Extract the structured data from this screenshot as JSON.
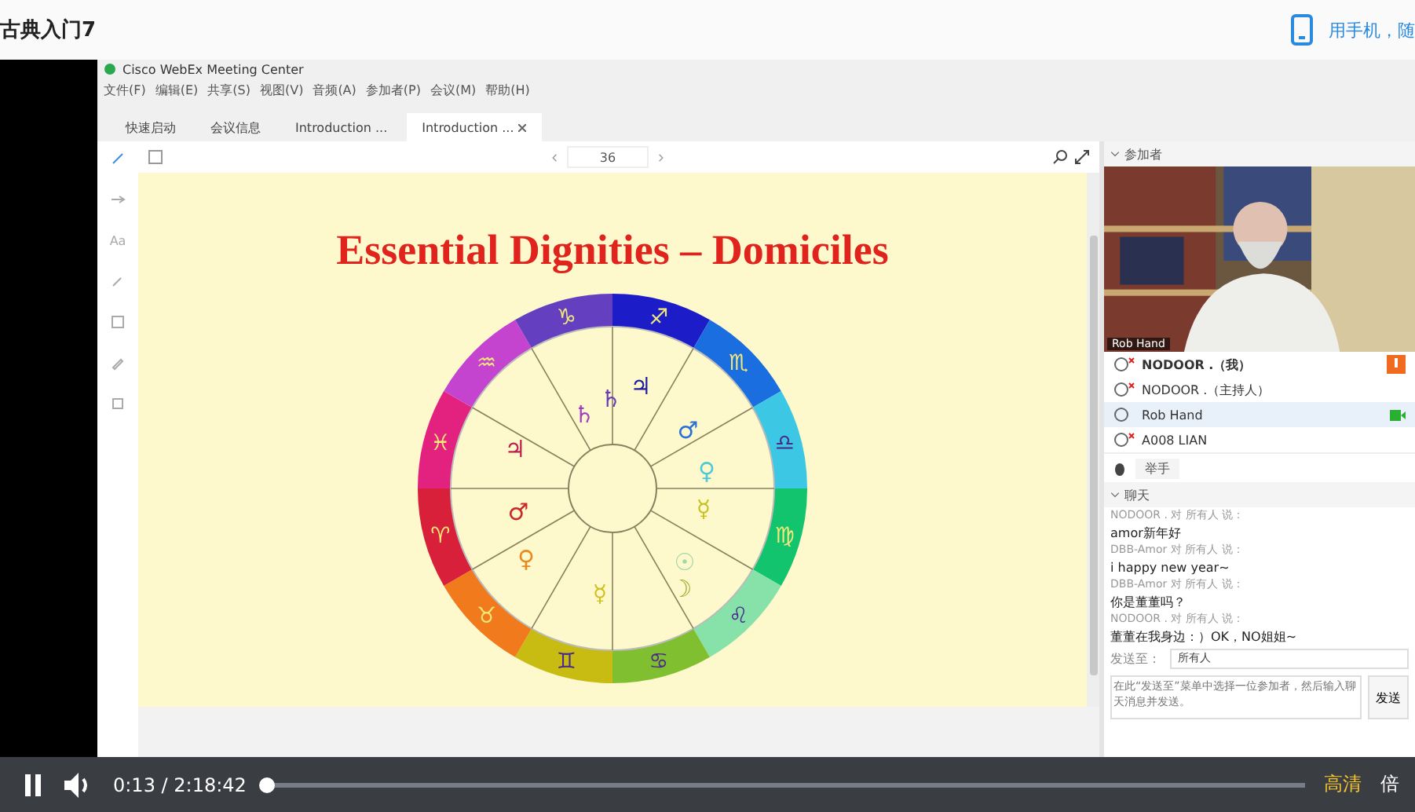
{
  "page": {
    "title": "古典入门7",
    "mobile_link": "用手机，随"
  },
  "window": {
    "title": "Cisco WebEx Meeting Center"
  },
  "menu": [
    "文件(F)",
    "编辑(E)",
    "共享(S)",
    "视图(V)",
    "音频(A)",
    "参加者(P)",
    "会议(M)",
    "帮助(H)"
  ],
  "tabs": [
    {
      "label": "快速启动",
      "selected": false,
      "closable": false
    },
    {
      "label": "会议信息",
      "selected": false,
      "closable": false
    },
    {
      "label": "Introduction ...",
      "selected": false,
      "closable": false
    },
    {
      "label": "Introduction ...",
      "selected": true,
      "closable": true
    }
  ],
  "tools": [
    {
      "kind": "icon",
      "selected": true
    },
    {
      "kind": "icon",
      "selected": false
    },
    {
      "kind": "text",
      "label": "Aa",
      "selected": false
    },
    {
      "kind": "icon",
      "selected": false
    },
    {
      "kind": "icon",
      "selected": false
    },
    {
      "kind": "icon",
      "selected": false
    },
    {
      "kind": "icon",
      "selected": false
    }
  ],
  "viewer": {
    "zoom": "36",
    "slide": {
      "title": "Essential Dignities – Domiciles",
      "signs": [
        {
          "glyph": "♐",
          "color": "#1c1cc8"
        },
        {
          "glyph": "♏",
          "color": "#1a6ee0"
        },
        {
          "glyph": "♎",
          "color": "#3cc8e4"
        },
        {
          "glyph": "♍",
          "color": "#12c46e"
        },
        {
          "glyph": "♌",
          "color": "#86e2a8"
        },
        {
          "glyph": "♋",
          "color": "#80c030"
        },
        {
          "glyph": "♊",
          "color": "#c8bc12"
        },
        {
          "glyph": "♉",
          "color": "#f07a1c"
        },
        {
          "glyph": "♈",
          "color": "#d8203a"
        },
        {
          "glyph": "♓",
          "color": "#e2227e"
        },
        {
          "glyph": "♒",
          "color": "#c444d0"
        },
        {
          "glyph": "♑",
          "color": "#6440c0"
        }
      ],
      "planets": [
        {
          "glyph": "♃",
          "color": "#2020a0"
        },
        {
          "glyph": "♄",
          "color": "#6a3cb8"
        },
        {
          "glyph": "♄",
          "color": "#a040c0"
        },
        {
          "glyph": "♂",
          "color": "#2a70d8"
        },
        {
          "glyph": "♃",
          "color": "#c02050"
        },
        {
          "glyph": "♀",
          "color": "#50c8d8"
        },
        {
          "glyph": "☿",
          "color": "#c8c020"
        },
        {
          "glyph": "♂",
          "color": "#c82828"
        },
        {
          "glyph": "♀",
          "color": "#e88a20"
        },
        {
          "glyph": "☉",
          "color": "#a0d8a8"
        },
        {
          "glyph": "☽",
          "color": "#a8a830"
        },
        {
          "glyph": "☿",
          "color": "#d0c020"
        }
      ]
    }
  },
  "participants": {
    "title": "参加者",
    "video_label": "Rob Hand",
    "rows": [
      {
        "name": "NODOOR .（我）",
        "muted": true,
        "me": true,
        "selected": false,
        "video": false
      },
      {
        "name": "NODOOR .（主持人）",
        "muted": true,
        "me": false,
        "selected": false,
        "video": false
      },
      {
        "name": "Rob Hand",
        "muted": false,
        "me": false,
        "selected": true,
        "video": true
      },
      {
        "name": "A008 LIAN",
        "muted": true,
        "me": false,
        "selected": false,
        "video": false
      }
    ],
    "raise_hand": "举手"
  },
  "chat": {
    "title": "聊天",
    "messages": [
      {
        "kind": "sender",
        "text": "NODOOR . 对 所有人 说："
      },
      {
        "kind": "body",
        "text": "amor新年好"
      },
      {
        "kind": "sender",
        "text": "DBB-Amor 对 所有人 说："
      },
      {
        "kind": "body",
        "text": "i happy new year~"
      },
      {
        "kind": "sender",
        "text": "DBB-Amor 对 所有人 说："
      },
      {
        "kind": "body",
        "text": "你是董董吗？"
      },
      {
        "kind": "sender",
        "text": "NODOOR . 对 所有人 说："
      },
      {
        "kind": "body",
        "text": "董董在我身边：）OK，NO姐姐~"
      }
    ],
    "send_to_label": "发送至：",
    "send_to": "所有人",
    "placeholder": "在此“发送至”菜单中选择一位参加者，然后输入聊天消息并发送。",
    "send": "发送"
  },
  "player": {
    "playing": true,
    "elapsed": "0:13",
    "separator": "/",
    "duration": "2:18:42",
    "level": 0.002,
    "quality": "高清",
    "speed": "倍"
  }
}
